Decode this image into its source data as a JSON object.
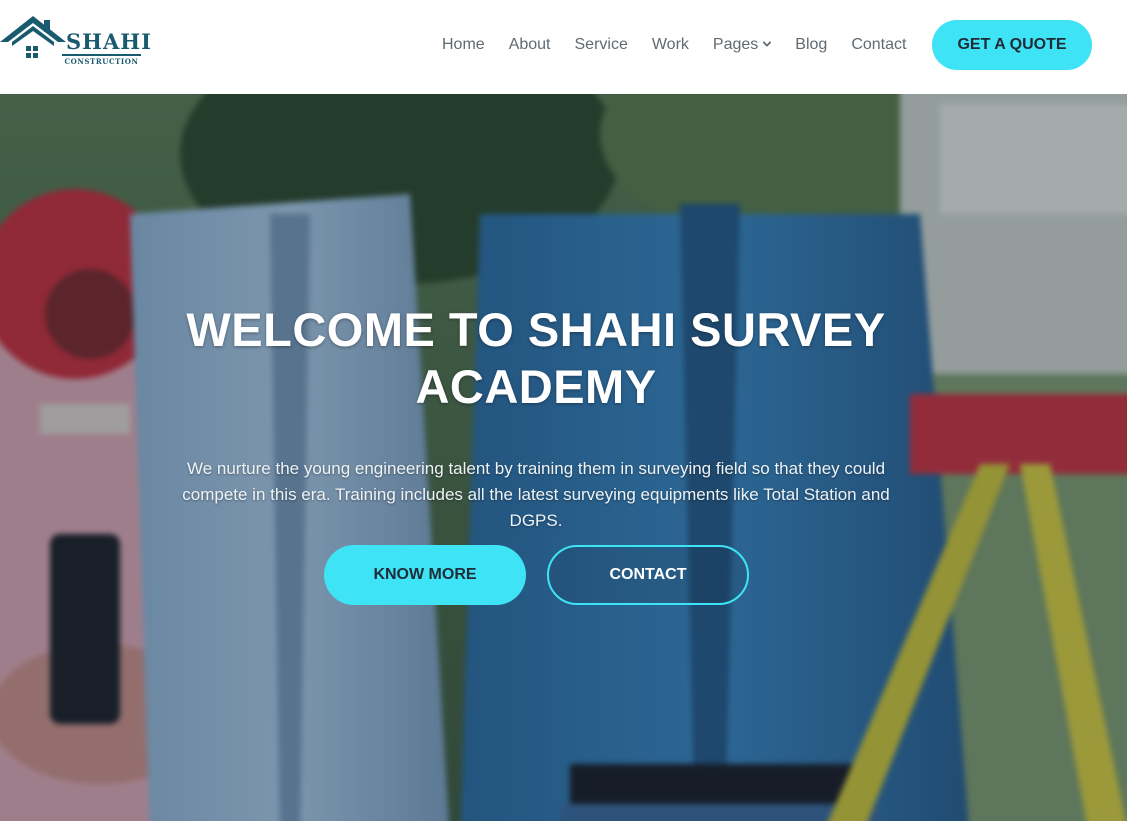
{
  "brand": {
    "name": "SHAHI",
    "tagline": "CONSTRUCTION",
    "color": "#1a5a6e"
  },
  "nav": {
    "items": [
      {
        "label": "Home"
      },
      {
        "label": "About"
      },
      {
        "label": "Service"
      },
      {
        "label": "Work"
      },
      {
        "label": "Pages",
        "has_dropdown": true,
        "icon": "chevron-down-icon"
      },
      {
        "label": "Blog"
      },
      {
        "label": "Contact"
      }
    ],
    "cta_label": "GET A QUOTE",
    "cta_color": "#3ee3f5"
  },
  "hero": {
    "title": "WELCOME TO SHAHI SURVEY ACADEMY",
    "text": "We nurture the young engineering talent by training them in surveying field so that they could compete in this era. Training includes all the latest surveying equipments like Total Station and DGPS.",
    "primary_button": "KNOW MORE",
    "secondary_button": "CONTACT",
    "accent_color": "#3ee3f5"
  }
}
